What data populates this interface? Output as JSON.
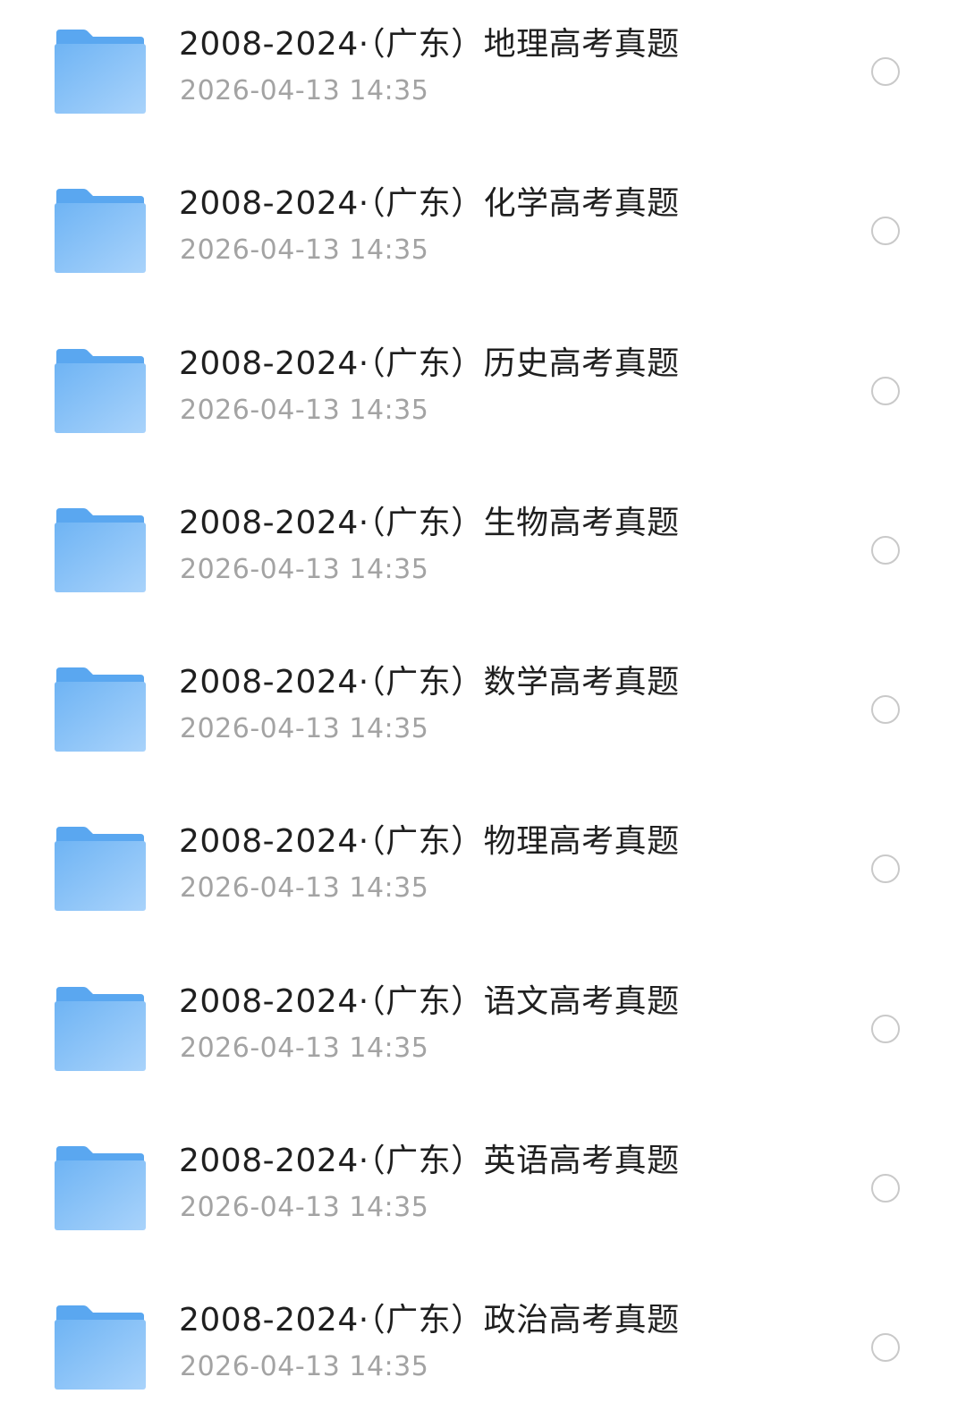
{
  "files": [
    {
      "name": "2008-2024·（广东）地理高考真题",
      "modified": "2026-04-13 14:35"
    },
    {
      "name": "2008-2024·（广东）化学高考真题",
      "modified": "2026-04-13 14:35"
    },
    {
      "name": "2008-2024·（广东）历史高考真题",
      "modified": "2026-04-13 14:35"
    },
    {
      "name": "2008-2024·（广东）生物高考真题",
      "modified": "2026-04-13 14:35"
    },
    {
      "name": "2008-2024·（广东）数学高考真题",
      "modified": "2026-04-13 14:35"
    },
    {
      "name": "2008-2024·（广东）物理高考真题",
      "modified": "2026-04-13 14:35"
    },
    {
      "name": "2008-2024·（广东）语文高考真题",
      "modified": "2026-04-13 14:35"
    },
    {
      "name": "2008-2024·（广东）英语高考真题",
      "modified": "2026-04-13 14:35"
    },
    {
      "name": "2008-2024·（广东）政治高考真题",
      "modified": "2026-04-13 14:35"
    }
  ],
  "icons": {
    "folder": "folder-icon",
    "select": "radio-unchecked"
  },
  "colors": {
    "folder_back": "#5aa7f0",
    "folder_front_top": "#6fb4f4",
    "folder_front_bottom": "#a9d3fb",
    "title_text": "#1f1f1f",
    "meta_text": "#a3a3a3",
    "radio_border": "#c9c9c9"
  }
}
